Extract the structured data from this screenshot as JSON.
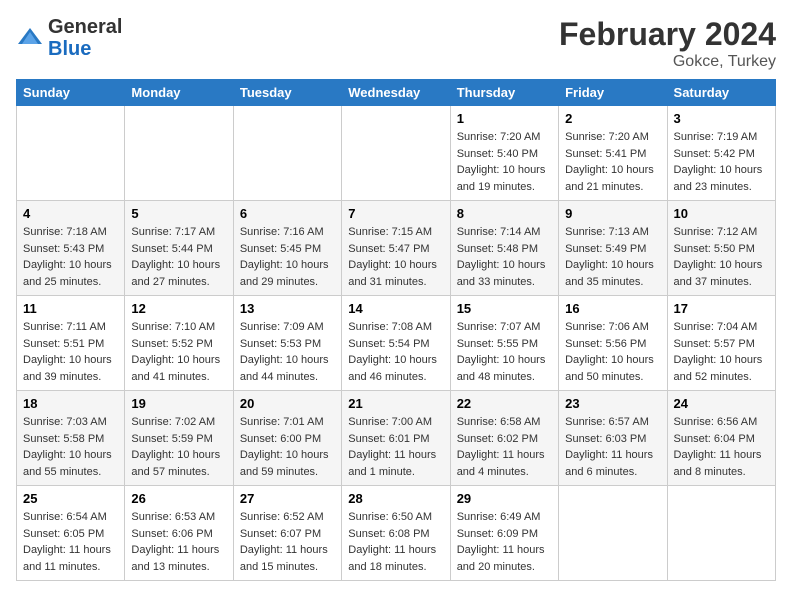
{
  "header": {
    "logo_general": "General",
    "logo_blue": "Blue",
    "month_title": "February 2024",
    "location": "Gokce, Turkey"
  },
  "days_of_week": [
    "Sunday",
    "Monday",
    "Tuesday",
    "Wednesday",
    "Thursday",
    "Friday",
    "Saturday"
  ],
  "weeks": [
    [
      {
        "day": "",
        "sunrise": "",
        "sunset": "",
        "daylight": ""
      },
      {
        "day": "",
        "sunrise": "",
        "sunset": "",
        "daylight": ""
      },
      {
        "day": "",
        "sunrise": "",
        "sunset": "",
        "daylight": ""
      },
      {
        "day": "",
        "sunrise": "",
        "sunset": "",
        "daylight": ""
      },
      {
        "day": "1",
        "sunrise": "Sunrise: 7:20 AM",
        "sunset": "Sunset: 5:40 PM",
        "daylight": "Daylight: 10 hours and 19 minutes."
      },
      {
        "day": "2",
        "sunrise": "Sunrise: 7:20 AM",
        "sunset": "Sunset: 5:41 PM",
        "daylight": "Daylight: 10 hours and 21 minutes."
      },
      {
        "day": "3",
        "sunrise": "Sunrise: 7:19 AM",
        "sunset": "Sunset: 5:42 PM",
        "daylight": "Daylight: 10 hours and 23 minutes."
      }
    ],
    [
      {
        "day": "4",
        "sunrise": "Sunrise: 7:18 AM",
        "sunset": "Sunset: 5:43 PM",
        "daylight": "Daylight: 10 hours and 25 minutes."
      },
      {
        "day": "5",
        "sunrise": "Sunrise: 7:17 AM",
        "sunset": "Sunset: 5:44 PM",
        "daylight": "Daylight: 10 hours and 27 minutes."
      },
      {
        "day": "6",
        "sunrise": "Sunrise: 7:16 AM",
        "sunset": "Sunset: 5:45 PM",
        "daylight": "Daylight: 10 hours and 29 minutes."
      },
      {
        "day": "7",
        "sunrise": "Sunrise: 7:15 AM",
        "sunset": "Sunset: 5:47 PM",
        "daylight": "Daylight: 10 hours and 31 minutes."
      },
      {
        "day": "8",
        "sunrise": "Sunrise: 7:14 AM",
        "sunset": "Sunset: 5:48 PM",
        "daylight": "Daylight: 10 hours and 33 minutes."
      },
      {
        "day": "9",
        "sunrise": "Sunrise: 7:13 AM",
        "sunset": "Sunset: 5:49 PM",
        "daylight": "Daylight: 10 hours and 35 minutes."
      },
      {
        "day": "10",
        "sunrise": "Sunrise: 7:12 AM",
        "sunset": "Sunset: 5:50 PM",
        "daylight": "Daylight: 10 hours and 37 minutes."
      }
    ],
    [
      {
        "day": "11",
        "sunrise": "Sunrise: 7:11 AM",
        "sunset": "Sunset: 5:51 PM",
        "daylight": "Daylight: 10 hours and 39 minutes."
      },
      {
        "day": "12",
        "sunrise": "Sunrise: 7:10 AM",
        "sunset": "Sunset: 5:52 PM",
        "daylight": "Daylight: 10 hours and 41 minutes."
      },
      {
        "day": "13",
        "sunrise": "Sunrise: 7:09 AM",
        "sunset": "Sunset: 5:53 PM",
        "daylight": "Daylight: 10 hours and 44 minutes."
      },
      {
        "day": "14",
        "sunrise": "Sunrise: 7:08 AM",
        "sunset": "Sunset: 5:54 PM",
        "daylight": "Daylight: 10 hours and 46 minutes."
      },
      {
        "day": "15",
        "sunrise": "Sunrise: 7:07 AM",
        "sunset": "Sunset: 5:55 PM",
        "daylight": "Daylight: 10 hours and 48 minutes."
      },
      {
        "day": "16",
        "sunrise": "Sunrise: 7:06 AM",
        "sunset": "Sunset: 5:56 PM",
        "daylight": "Daylight: 10 hours and 50 minutes."
      },
      {
        "day": "17",
        "sunrise": "Sunrise: 7:04 AM",
        "sunset": "Sunset: 5:57 PM",
        "daylight": "Daylight: 10 hours and 52 minutes."
      }
    ],
    [
      {
        "day": "18",
        "sunrise": "Sunrise: 7:03 AM",
        "sunset": "Sunset: 5:58 PM",
        "daylight": "Daylight: 10 hours and 55 minutes."
      },
      {
        "day": "19",
        "sunrise": "Sunrise: 7:02 AM",
        "sunset": "Sunset: 5:59 PM",
        "daylight": "Daylight: 10 hours and 57 minutes."
      },
      {
        "day": "20",
        "sunrise": "Sunrise: 7:01 AM",
        "sunset": "Sunset: 6:00 PM",
        "daylight": "Daylight: 10 hours and 59 minutes."
      },
      {
        "day": "21",
        "sunrise": "Sunrise: 7:00 AM",
        "sunset": "Sunset: 6:01 PM",
        "daylight": "Daylight: 11 hours and 1 minute."
      },
      {
        "day": "22",
        "sunrise": "Sunrise: 6:58 AM",
        "sunset": "Sunset: 6:02 PM",
        "daylight": "Daylight: 11 hours and 4 minutes."
      },
      {
        "day": "23",
        "sunrise": "Sunrise: 6:57 AM",
        "sunset": "Sunset: 6:03 PM",
        "daylight": "Daylight: 11 hours and 6 minutes."
      },
      {
        "day": "24",
        "sunrise": "Sunrise: 6:56 AM",
        "sunset": "Sunset: 6:04 PM",
        "daylight": "Daylight: 11 hours and 8 minutes."
      }
    ],
    [
      {
        "day": "25",
        "sunrise": "Sunrise: 6:54 AM",
        "sunset": "Sunset: 6:05 PM",
        "daylight": "Daylight: 11 hours and 11 minutes."
      },
      {
        "day": "26",
        "sunrise": "Sunrise: 6:53 AM",
        "sunset": "Sunset: 6:06 PM",
        "daylight": "Daylight: 11 hours and 13 minutes."
      },
      {
        "day": "27",
        "sunrise": "Sunrise: 6:52 AM",
        "sunset": "Sunset: 6:07 PM",
        "daylight": "Daylight: 11 hours and 15 minutes."
      },
      {
        "day": "28",
        "sunrise": "Sunrise: 6:50 AM",
        "sunset": "Sunset: 6:08 PM",
        "daylight": "Daylight: 11 hours and 18 minutes."
      },
      {
        "day": "29",
        "sunrise": "Sunrise: 6:49 AM",
        "sunset": "Sunset: 6:09 PM",
        "daylight": "Daylight: 11 hours and 20 minutes."
      },
      {
        "day": "",
        "sunrise": "",
        "sunset": "",
        "daylight": ""
      },
      {
        "day": "",
        "sunrise": "",
        "sunset": "",
        "daylight": ""
      }
    ]
  ]
}
